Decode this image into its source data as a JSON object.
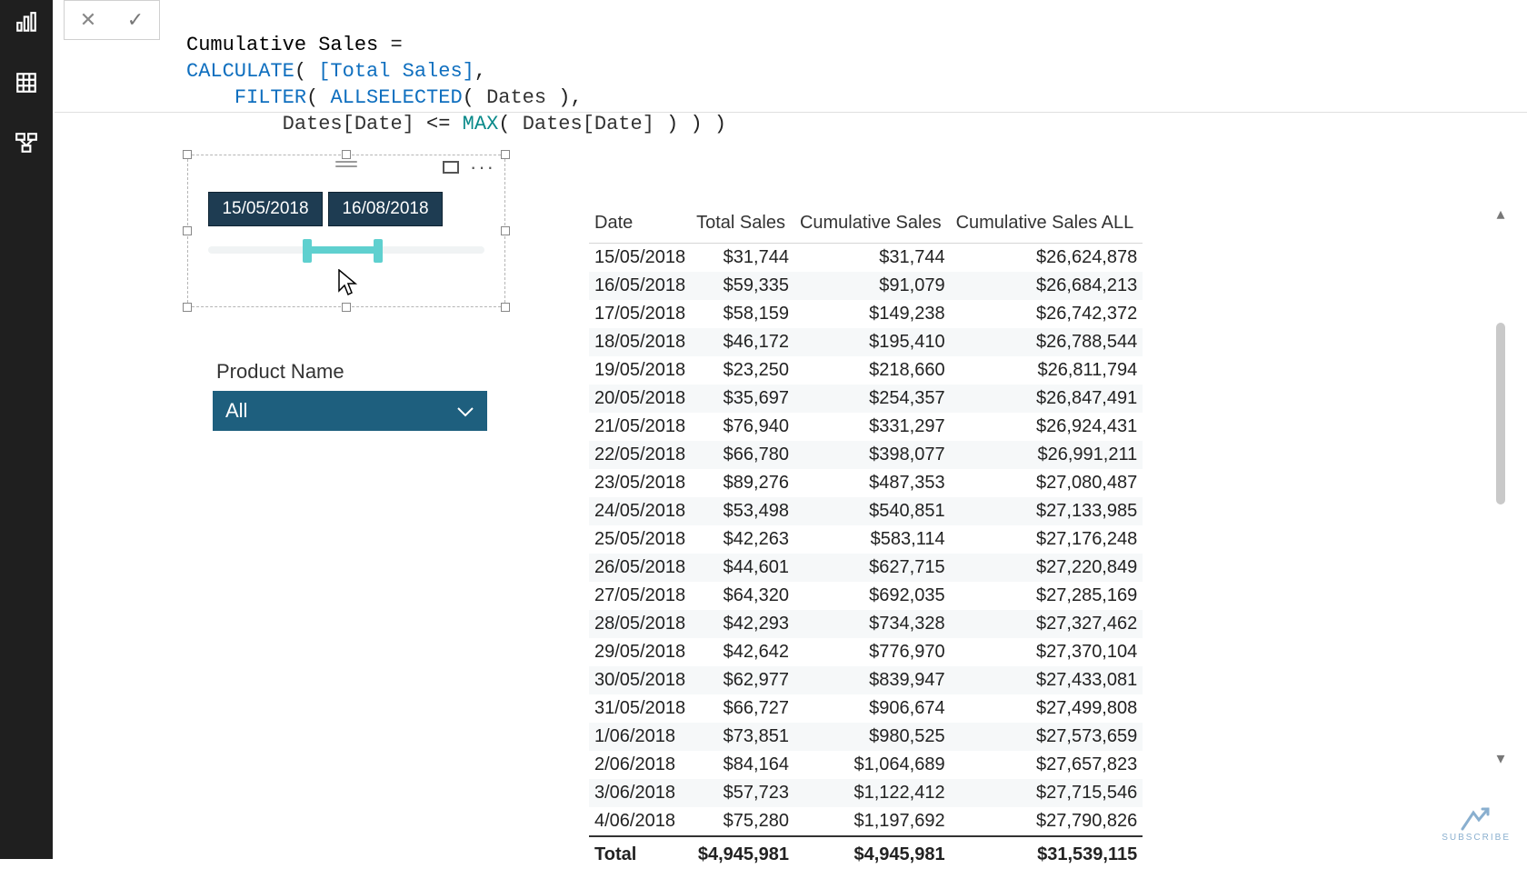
{
  "formula": {
    "line1_a": "Cumulative Sales ",
    "line1_b": "=",
    "line2_calc": "CALCULATE",
    "line2_paren_open": "( ",
    "line2_measure": "[Total Sales]",
    "line2_comma": ",",
    "line3_indent": "    ",
    "line3_filter": "FILTER",
    "line3_paren_open": "( ",
    "line3_allsel": "ALLSELECTED",
    "line3_paren2": "( ",
    "line3_table": "Dates",
    "line3_close": " ),",
    "line4_indent": "        ",
    "line4_col1": "Dates[Date]",
    "line4_op": " <= ",
    "line4_max": "MAX",
    "line4_paren": "( ",
    "line4_col2": "Dates[Date]",
    "line4_close": " ) ) )"
  },
  "slicer": {
    "start": "15/05/2018",
    "end": "16/08/2018"
  },
  "product": {
    "label": "Product Name",
    "value": "All"
  },
  "table": {
    "headers": [
      "Date",
      "Total Sales",
      "Cumulative Sales",
      "Cumulative Sales ALL"
    ],
    "rows": [
      [
        "15/05/2018",
        "$31,744",
        "$31,744",
        "$26,624,878"
      ],
      [
        "16/05/2018",
        "$59,335",
        "$91,079",
        "$26,684,213"
      ],
      [
        "17/05/2018",
        "$58,159",
        "$149,238",
        "$26,742,372"
      ],
      [
        "18/05/2018",
        "$46,172",
        "$195,410",
        "$26,788,544"
      ],
      [
        "19/05/2018",
        "$23,250",
        "$218,660",
        "$26,811,794"
      ],
      [
        "20/05/2018",
        "$35,697",
        "$254,357",
        "$26,847,491"
      ],
      [
        "21/05/2018",
        "$76,940",
        "$331,297",
        "$26,924,431"
      ],
      [
        "22/05/2018",
        "$66,780",
        "$398,077",
        "$26,991,211"
      ],
      [
        "23/05/2018",
        "$89,276",
        "$487,353",
        "$27,080,487"
      ],
      [
        "24/05/2018",
        "$53,498",
        "$540,851",
        "$27,133,985"
      ],
      [
        "25/05/2018",
        "$42,263",
        "$583,114",
        "$27,176,248"
      ],
      [
        "26/05/2018",
        "$44,601",
        "$627,715",
        "$27,220,849"
      ],
      [
        "27/05/2018",
        "$64,320",
        "$692,035",
        "$27,285,169"
      ],
      [
        "28/05/2018",
        "$42,293",
        "$734,328",
        "$27,327,462"
      ],
      [
        "29/05/2018",
        "$42,642",
        "$776,970",
        "$27,370,104"
      ],
      [
        "30/05/2018",
        "$62,977",
        "$839,947",
        "$27,433,081"
      ],
      [
        "31/05/2018",
        "$66,727",
        "$906,674",
        "$27,499,808"
      ],
      [
        "1/06/2018",
        "$73,851",
        "$980,525",
        "$27,573,659"
      ],
      [
        "2/06/2018",
        "$84,164",
        "$1,064,689",
        "$27,657,823"
      ],
      [
        "3/06/2018",
        "$57,723",
        "$1,122,412",
        "$27,715,546"
      ],
      [
        "4/06/2018",
        "$75,280",
        "$1,197,692",
        "$27,790,826"
      ]
    ],
    "total_label": "Total",
    "totals": [
      "$4,945,981",
      "$4,945,981",
      "$31,539,115"
    ]
  },
  "watermark": {
    "text": "SUBSCRIBE"
  }
}
